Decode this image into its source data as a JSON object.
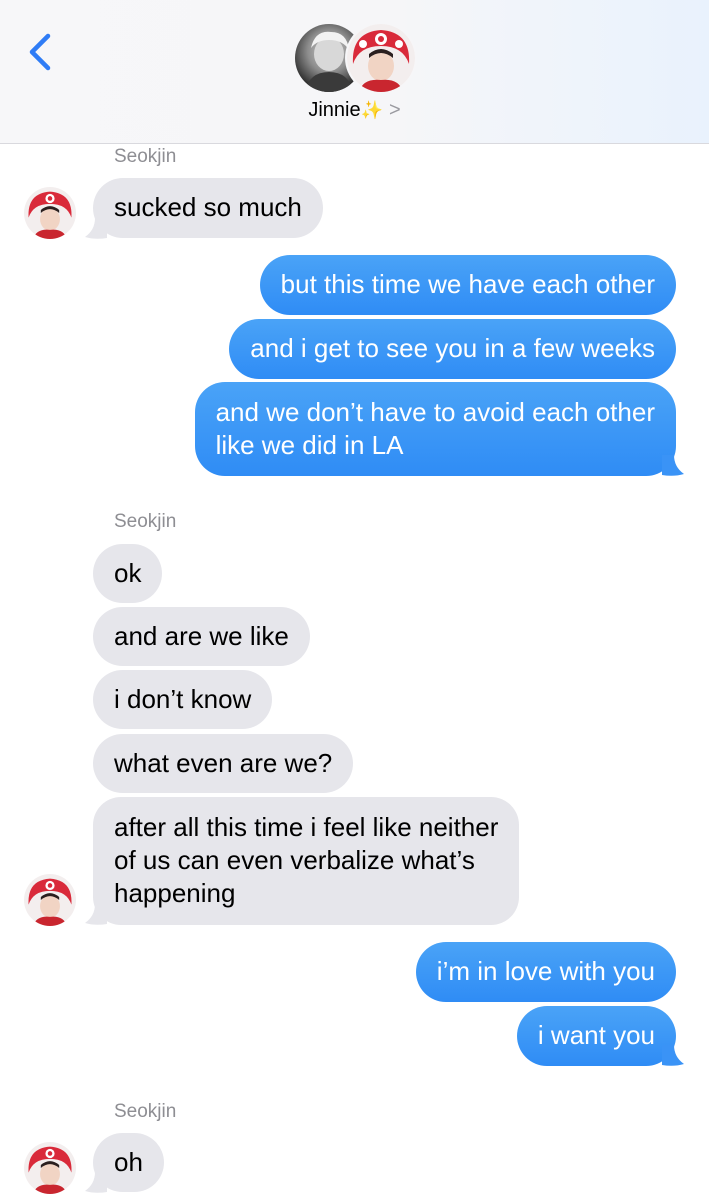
{
  "header": {
    "contact_name": "Jinnie",
    "sparkle": "✨",
    "chevron": ">",
    "back_icon": "chevron-left-icon",
    "accent": "#2f7cf6"
  },
  "colors": {
    "incoming_bubble": "#e6e6eb",
    "outgoing_bubble": "#3a93f6"
  },
  "messages": [
    {
      "sender": "Seokjin"
    },
    {
      "text": "sucked so much"
    },
    {
      "text": "but this time we have each other"
    },
    {
      "text": "and i get to see you in a few weeks"
    },
    {
      "line1": "and we don’t have to avoid each other",
      "line2": "like we did in LA"
    },
    {
      "sender": "Seokjin"
    },
    {
      "text": "ok"
    },
    {
      "text": "and are we like"
    },
    {
      "text": "i don’t know"
    },
    {
      "text": "what even are we?"
    },
    {
      "line1": "after all this time i feel like neither",
      "line2": "of us can even verbalize what’s",
      "line3": "happening"
    },
    {
      "text": "i’m in love with you"
    },
    {
      "text": "i want you"
    },
    {
      "sender": "Seokjin"
    },
    {
      "text": "oh"
    }
  ]
}
